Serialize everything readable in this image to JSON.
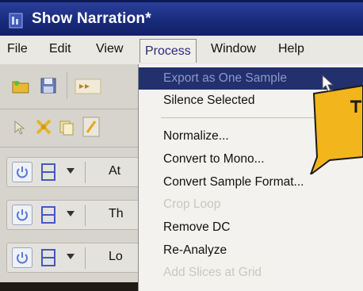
{
  "window": {
    "title": "Show Narration*"
  },
  "menubar": {
    "items": [
      {
        "label": "File"
      },
      {
        "label": "Edit"
      },
      {
        "label": "View"
      },
      {
        "label": "Process"
      },
      {
        "label": "Window"
      },
      {
        "label": "Help"
      }
    ]
  },
  "process_menu": {
    "items": [
      {
        "label": "Export as One Sample",
        "state": "highlighted"
      },
      {
        "label": "Silence Selected",
        "state": "enabled"
      },
      {
        "label": "Normalize...",
        "state": "enabled"
      },
      {
        "label": "Convert to Mono...",
        "state": "enabled"
      },
      {
        "label": "Convert Sample Format...",
        "state": "enabled"
      },
      {
        "label": "Crop Loop",
        "state": "disabled"
      },
      {
        "label": "Remove DC",
        "state": "enabled"
      },
      {
        "label": "Re-Analyze",
        "state": "enabled"
      },
      {
        "label": "Add Slices at Grid",
        "state": "disabled"
      }
    ]
  },
  "tracks": [
    {
      "name": "At"
    },
    {
      "name": "Th"
    },
    {
      "name": "Lo"
    }
  ],
  "colors": {
    "titlebar": "#18297a",
    "highlight": "#22306e",
    "callout": "#f2b51c"
  }
}
